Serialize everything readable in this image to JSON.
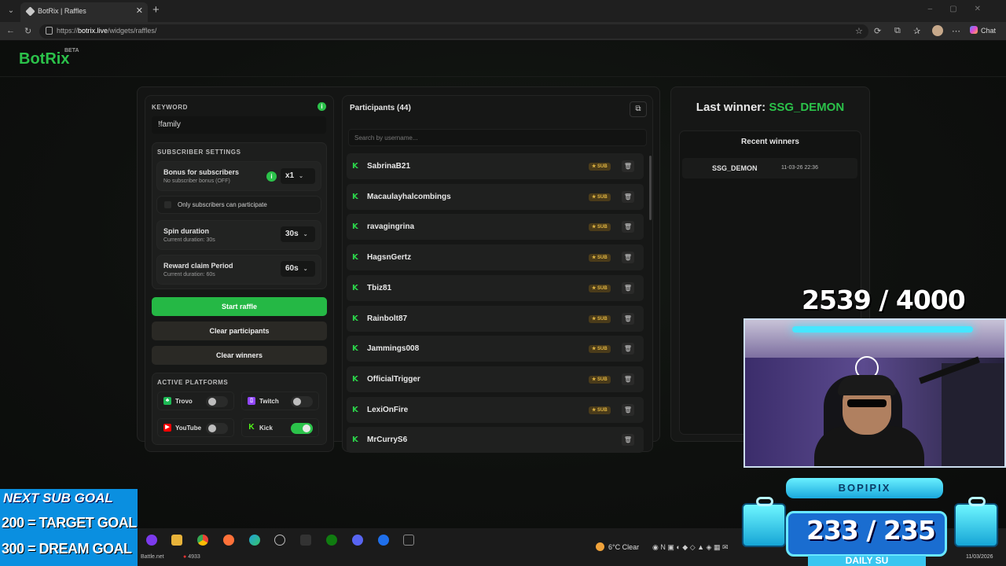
{
  "browser": {
    "tab_title": "BotRix | Raffles",
    "url_scheme": "https://",
    "url_host": "botrix.live",
    "url_path": "/widgets/raffles/",
    "chat_label": "Chat"
  },
  "app": {
    "logo": "BotRix",
    "logo_badge": "BETA"
  },
  "keyword": {
    "label": "KEYWORD",
    "value": "!family"
  },
  "subscriber_settings": {
    "label": "SUBSCRIBER SETTINGS",
    "bonus_title": "Bonus for subscribers",
    "bonus_sub": "No subscriber bonus (OFF)",
    "bonus_value": "x1",
    "only_subs_label": "Only subscribers can participate",
    "spin_title": "Spin duration",
    "spin_sub": "Current duration: 30s",
    "spin_value": "30s",
    "claim_title": "Reward claim Period",
    "claim_sub": "Current duration: 60s",
    "claim_value": "60s"
  },
  "buttons": {
    "start": "Start raffle",
    "clear_participants": "Clear participants",
    "clear_winners": "Clear winners"
  },
  "platforms": {
    "label": "ACTIVE PLATFORMS",
    "items": [
      {
        "name": "Trovo",
        "enabled": false,
        "icon": "trovo-icon",
        "color": "#1db954"
      },
      {
        "name": "Twitch",
        "enabled": false,
        "icon": "twitch-icon",
        "color": "#9146ff"
      },
      {
        "name": "YouTube",
        "enabled": false,
        "icon": "youtube-icon",
        "color": "#ff0000"
      },
      {
        "name": "Kick",
        "enabled": true,
        "icon": "kick-icon",
        "color": "#53fc18"
      }
    ]
  },
  "participants": {
    "title": "Participants (44)",
    "search_placeholder": "Search by username...",
    "sub_badge": "SUB",
    "rows": [
      {
        "name": "SabrinaB21",
        "sub": true
      },
      {
        "name": "Macaulayhalcombings",
        "sub": true
      },
      {
        "name": "ravagingrina",
        "sub": true
      },
      {
        "name": "HagsnGertz",
        "sub": true
      },
      {
        "name": "Tbiz81",
        "sub": true
      },
      {
        "name": "Rainbolt87",
        "sub": true
      },
      {
        "name": "Jammings008",
        "sub": true
      },
      {
        "name": "OfficialTrigger",
        "sub": true
      },
      {
        "name": "LexiOnFire",
        "sub": true
      },
      {
        "name": "MrCurryS6",
        "sub": false
      }
    ]
  },
  "winners": {
    "last_label": "Last winner:",
    "last_name": "SSG_DEMON",
    "recent_title": "Recent winners",
    "recent": [
      {
        "name": "SSG_DEMON",
        "time": "11-03-26 22:36"
      }
    ]
  },
  "overlay": {
    "goal_count": "2539 / 4000",
    "next_sub_title": "NEXT SUB GOAL",
    "goal_line_1": "200 = TARGET GOAL",
    "goal_line_2": "300 = DREAM GOAL",
    "daily_count": "233 / 235",
    "daily_banner": "BOPIPIX",
    "daily_label": "DAILY SU"
  },
  "taskbar": {
    "battle_net": "Battle.net",
    "battle_count": "4933",
    "weather": "6°C  Clear",
    "date": "11/03/2026"
  }
}
